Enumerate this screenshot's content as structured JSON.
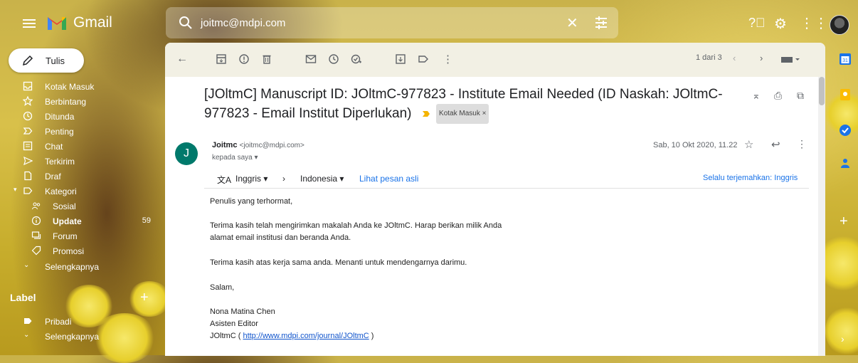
{
  "app": {
    "name": "Gmail"
  },
  "search": {
    "value": "joitmc@mdpi.com"
  },
  "compose": {
    "label": "Tulis"
  },
  "sidebar": {
    "items": [
      {
        "label": "Kotak Masuk",
        "icon": "inbox-icon"
      },
      {
        "label": "Berbintang",
        "icon": "star-icon"
      },
      {
        "label": "Ditunda",
        "icon": "clock-icon"
      },
      {
        "label": "Penting",
        "icon": "important-icon"
      },
      {
        "label": "Chat",
        "icon": "chat-icon"
      },
      {
        "label": "Terkirim",
        "icon": "send-icon"
      },
      {
        "label": "Draf",
        "icon": "draft-icon"
      },
      {
        "label": "Kategori",
        "icon": "label-icon"
      },
      {
        "label": "Sosial",
        "icon": "people-icon"
      },
      {
        "label": "Update",
        "icon": "info-icon",
        "count": "59"
      },
      {
        "label": "Forum",
        "icon": "forum-icon"
      },
      {
        "label": "Promosi",
        "icon": "tag-icon"
      },
      {
        "label": "Selengkapnya",
        "icon": "chevron-down-icon"
      }
    ],
    "labels_heading": "Label",
    "labels": [
      {
        "label": "Pribadi",
        "icon": "label-icon"
      },
      {
        "label": "Selengkapnya",
        "icon": "chevron-down-icon"
      }
    ]
  },
  "toolbar": {
    "pager": "1 dari 3"
  },
  "email": {
    "subject": "[JOltmC] Manuscript ID: JOltmC-977823 - Institute Email Needed (ID Naskah: JOltmC-977823 - Email Institut Diperlukan)",
    "label_chip": "Kotak Masuk ×",
    "sender_initial": "J",
    "sender_name": "Joitmc",
    "sender_email": "<joitmc@mdpi.com>",
    "recipient": "kepada saya ▾",
    "date": "Sab, 10 Okt 2020, 11.22",
    "translate": {
      "from": "Inggris",
      "to": "Indonesia",
      "view_original": "Lihat pesan asli",
      "always_translate": "Selalu terjemahkan: Inggris"
    },
    "body": [
      "Penulis yang terhormat,",
      "Terima kasih telah mengirimkan makalah Anda ke JOltmC. Harap berikan milik Anda",
      "alamat email institusi dan beranda Anda.",
      "Terima kasih atas kerja sama anda. Menanti untuk mendengarnya darimu.",
      "Salam,",
      "Nona Matina Chen",
      "Asisten Editor"
    ],
    "signature": {
      "prefix": "JOltmC ( ",
      "link": "http://www.mdpi.com/journal/JOltmC",
      "suffix": " )"
    }
  }
}
